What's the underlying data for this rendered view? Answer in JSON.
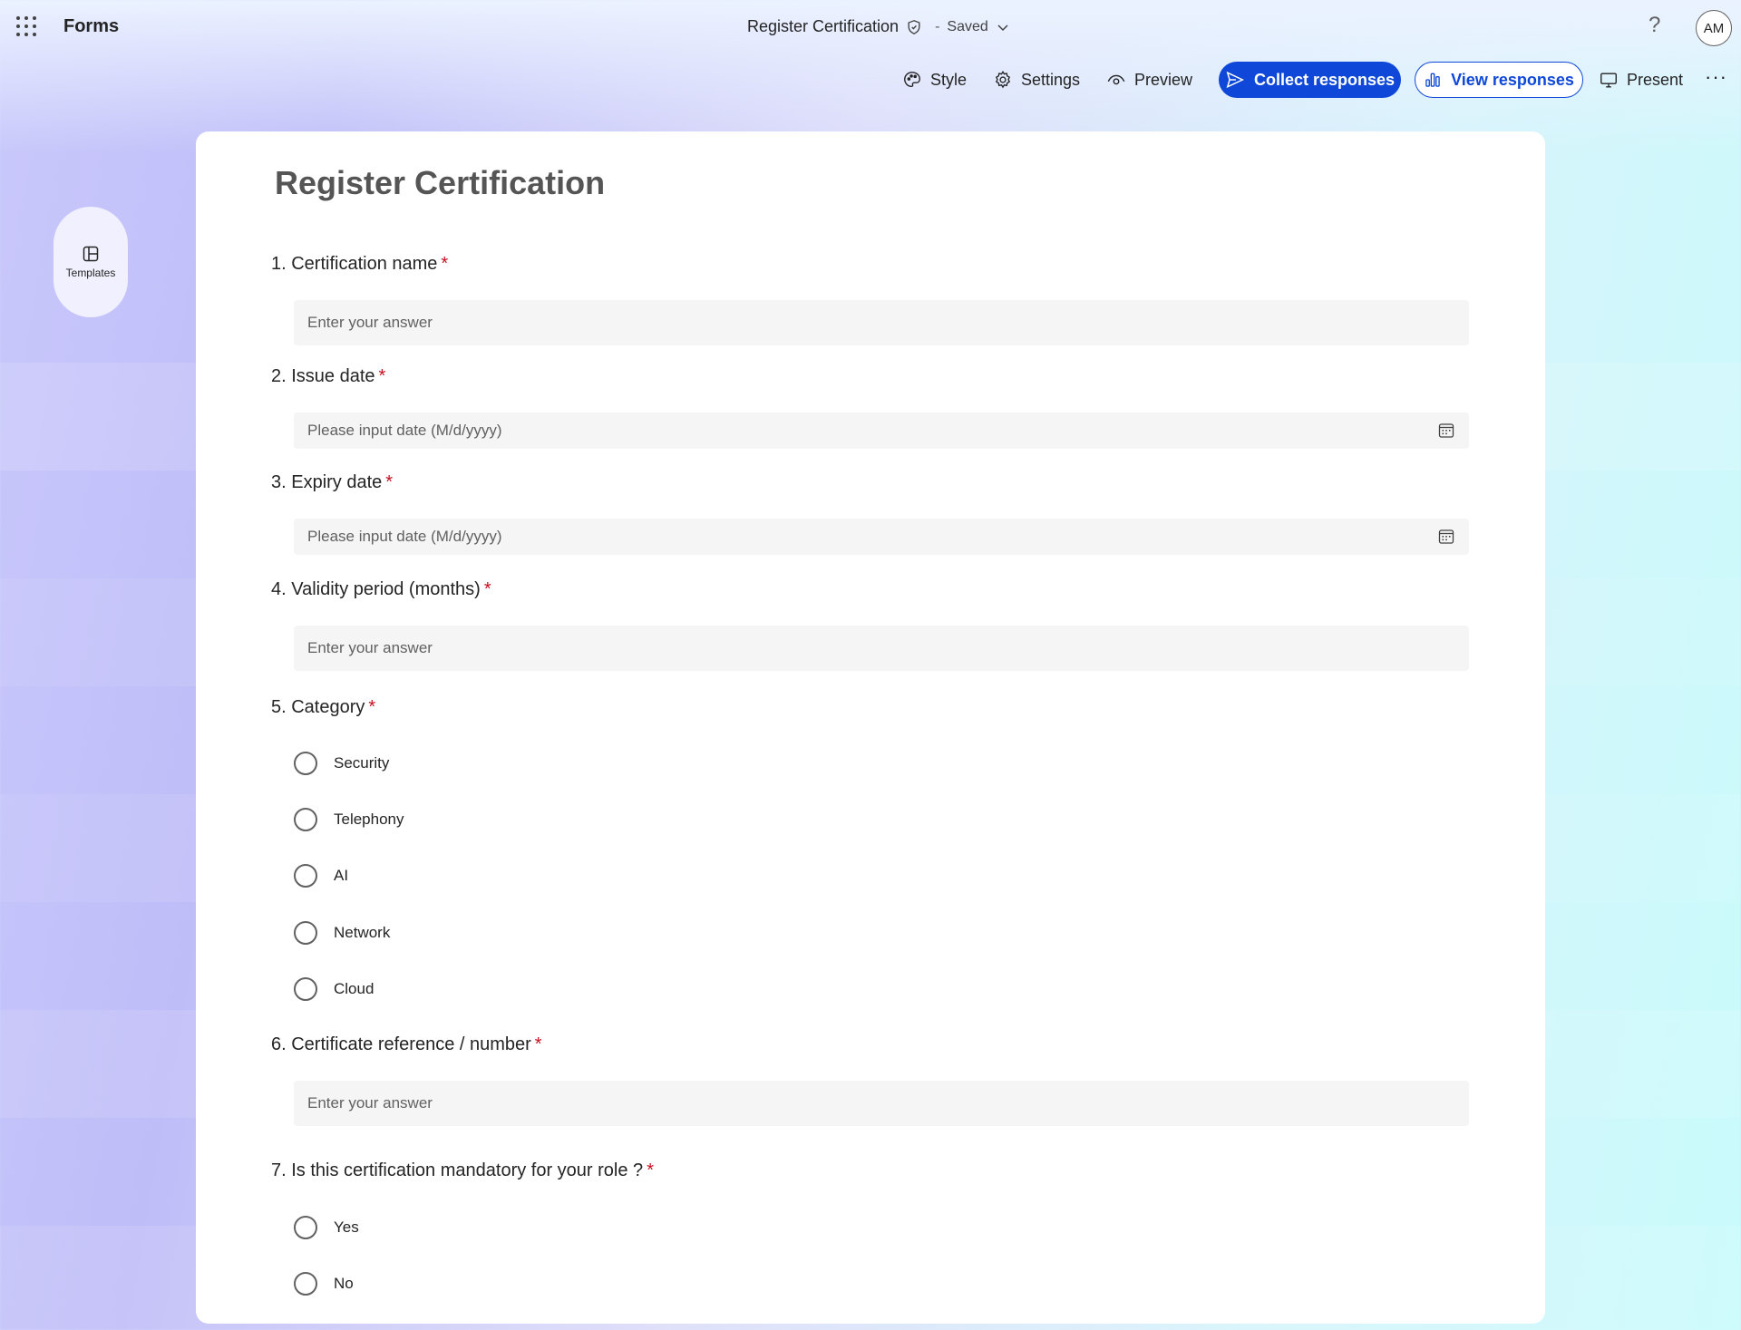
{
  "app": {
    "name": "Forms"
  },
  "document": {
    "title": "Register Certification",
    "separator": "-",
    "status": "Saved"
  },
  "header": {
    "help_label": "?",
    "avatar_initials": "AM"
  },
  "toolbar": {
    "style_label": "Style",
    "settings_label": "Settings",
    "preview_label": "Preview",
    "collect_label": "Collect responses",
    "view_label": "View responses",
    "present_label": "Present",
    "more_label": "···"
  },
  "rail": {
    "templates_label": "Templates"
  },
  "colors": {
    "accent": "#0f48d8",
    "required": "#c50f1f",
    "input_bg": "#f5f5f5"
  },
  "form": {
    "title": "Register Certification",
    "questions": [
      {
        "label": "1. Certification name",
        "required": "*",
        "placeholder": "Enter your answer"
      },
      {
        "label": "2. Issue date",
        "required": "*",
        "placeholder": "Please input date (M/d/yyyy)"
      },
      {
        "label": "3. Expiry date",
        "required": "*",
        "placeholder": "Please input date (M/d/yyyy)"
      },
      {
        "label": "4. Validity period (months)",
        "required": "*",
        "placeholder": "Enter your answer"
      },
      {
        "label": "5. Category",
        "required": "*",
        "options": [
          "Security",
          "Telephony",
          "AI",
          "Network",
          "Cloud"
        ]
      },
      {
        "label": "6. Certificate reference / number",
        "required": "*",
        "placeholder": "Enter your answer"
      },
      {
        "label": "7. Is this certification mandatory for your role ?",
        "required": "*",
        "options": [
          "Yes",
          "No"
        ]
      }
    ]
  }
}
